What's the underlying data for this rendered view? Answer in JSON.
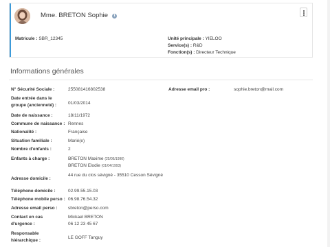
{
  "profile": {
    "name": "Mme. BRETON Sophie",
    "matricule_label": "Matricule :",
    "matricule_value": "SBR_12345",
    "unite_label": "Unité principale :",
    "unite_value": "YIELOO",
    "services_label": "Service(s) :",
    "services_value": "R&D",
    "fonctions_label": "Fonction(s) :",
    "fonctions_value": "Directeur Technique",
    "info_icon_name": "info-icon",
    "menu_icon_name": "kebab-menu-icon"
  },
  "section": {
    "title": "Informations générales"
  },
  "fields": {
    "secu_label": "N° Sécurité Sociale :",
    "secu_value": "255081416802538",
    "email_pro_label_right": "Adresse email pro :",
    "email_pro_value_right": "sophie.breton@mail.com",
    "entree_label": "Date entrée dans le groupe (ancienneté) :",
    "entree_value": "01/03/2014",
    "naissance_label": "Date de naissance :",
    "naissance_value": "18/11/1972",
    "commune_label": "Commune de naissance :",
    "commune_value": "Rennes",
    "nationalite_label": "Nationalité :",
    "nationalite_value": "Française",
    "situation_label": "Situation familiale :",
    "situation_value": "Marié(e)",
    "enfants_label": "Nombre d'enfants :",
    "enfants_value": "2",
    "charge_label": "Enfants à charge :",
    "child1_name": "BRETON Maxime",
    "child1_date": "(25/06/1990)",
    "child2_name": "BRETON Elodie",
    "child2_date": "(01/04/1993)",
    "adresse_label": "Adresse domicile :",
    "adresse_value": "44 rue du clos sévigné - 35510 Cesson Sévigné",
    "tel_dom_label": "Téléphone domicile :",
    "tel_dom_value": "02.99.55.15.03",
    "tel_mob_label": "Téléphone mobile perso :",
    "tel_mob_value": "06.98.76.54.32",
    "email_perso_label": "Adresse email perso :",
    "email_perso_value": "sbreton@perso.com",
    "urgence_label": "Contact en cas d'urgence :",
    "urgence_name": "Mickael BRETON",
    "urgence_phone": "06 12 23 45 67",
    "responsable_label": "Responsable hiérarchique :",
    "responsable_value": "LE GOFF Tanguy"
  },
  "colors": {
    "accent": "#3c9ad9",
    "link": "#2a76c9"
  }
}
